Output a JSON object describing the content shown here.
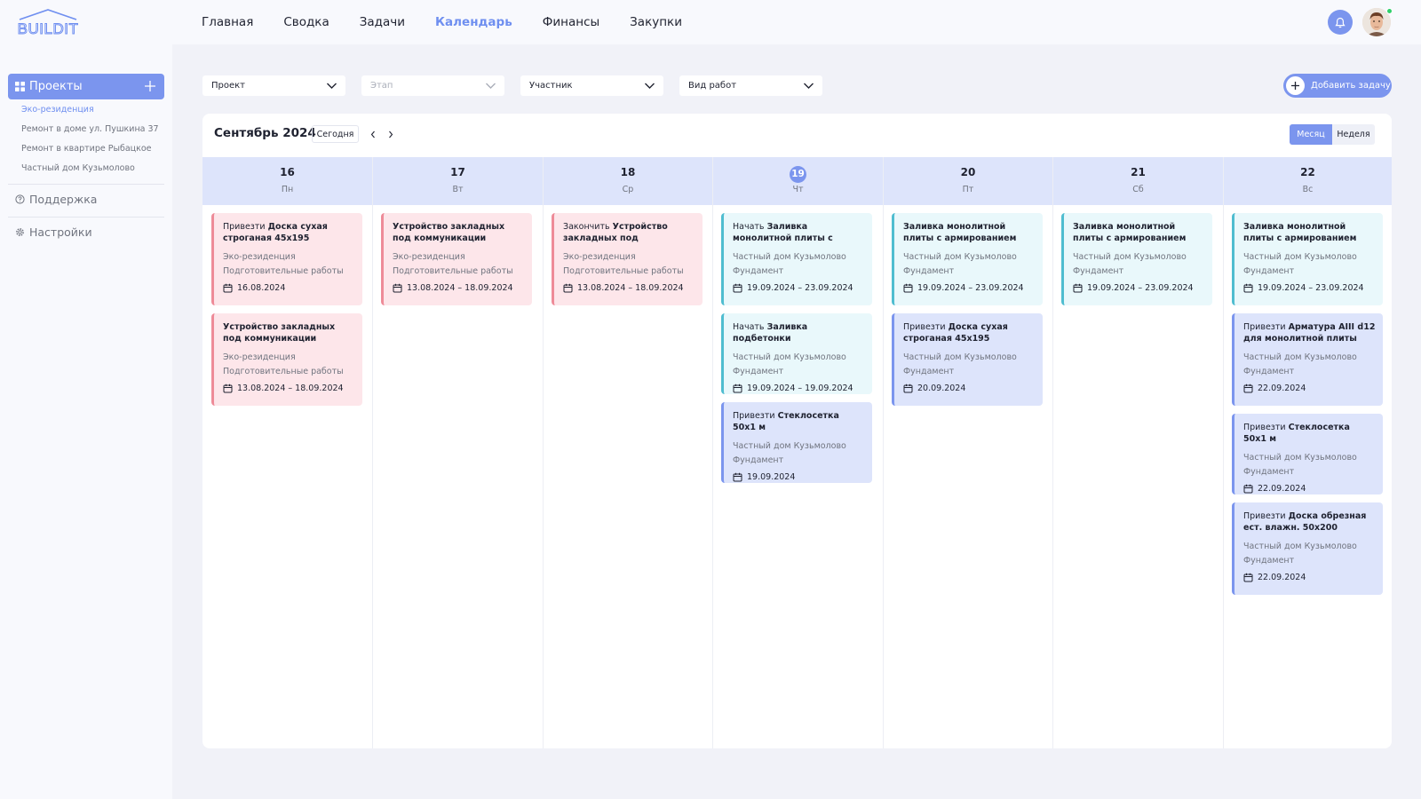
{
  "app": {
    "logo_text": "BUILDIT"
  },
  "nav": [
    {
      "label": "Главная"
    },
    {
      "label": "Сводка"
    },
    {
      "label": "Задачи"
    },
    {
      "label": "Календарь",
      "active": true
    },
    {
      "label": "Финансы"
    },
    {
      "label": "Закупки"
    }
  ],
  "sidebar": {
    "projects_label": "Проекты",
    "projects": [
      "Эко-резиденция",
      "Ремонт в доме ул. Пушкина 37",
      "Ремонт в квартире Рыбацкое",
      "Частный дом Кузьмолово"
    ],
    "support_label": "Поддержка",
    "settings_label": "Настройки"
  },
  "filters": [
    {
      "label": "Проект"
    },
    {
      "label": "Этап",
      "disabled": true
    },
    {
      "label": "Участник"
    },
    {
      "label": "Вид работ"
    }
  ],
  "add_task_label": "Добавить задачу",
  "calendar": {
    "title": "Сентябрь 2024",
    "today_label": "Сегодня",
    "view_month": "Месяц",
    "view_week": "Неделя",
    "days": [
      {
        "num": "16",
        "weekday": "Пн",
        "tasks": [
          {
            "color": "red",
            "prefix": "Привезти",
            "title": "Доска сухая строганая 45х195",
            "project": "Эко-резиденция",
            "stage": "Подготовительные работы",
            "date": "16.08.2024"
          },
          {
            "color": "red",
            "prefix": "",
            "title": "Устройство закладных под коммуникации",
            "project": "Эко-резиденция",
            "stage": "Подготовительные работы",
            "date": "13.08.2024 – 18.09.2024"
          }
        ]
      },
      {
        "num": "17",
        "weekday": "Вт",
        "tasks": [
          {
            "color": "red",
            "prefix": "",
            "title": "Устройство закладных под коммуникации",
            "project": "Эко-резиденция",
            "stage": "Подготовительные работы",
            "date": "13.08.2024 – 18.09.2024"
          }
        ]
      },
      {
        "num": "18",
        "weekday": "Ср",
        "tasks": [
          {
            "color": "red",
            "prefix": "Закончить",
            "title": "Устройство закладных под коммуникац...",
            "project": "Эко-резиденция",
            "stage": "Подготовительные работы",
            "date": "13.08.2024 – 18.09.2024"
          }
        ]
      },
      {
        "num": "19",
        "weekday": "Чт",
        "today": true,
        "tasks": [
          {
            "color": "teal",
            "prefix": "Начать",
            "title": "Заливка монолитной плиты с армированием",
            "project": "Частный дом Кузьмолово",
            "stage": "Фундамент",
            "date": "19.09.2024 – 23.09.2024"
          },
          {
            "color": "teal",
            "prefix": "Начать",
            "title": "Заливка подбетонки",
            "project": "Частный дом Кузьмолово",
            "stage": "Фундамент",
            "date": "19.09.2024 – 19.09.2024"
          },
          {
            "color": "blue",
            "prefix": "Привезти",
            "title": "Стеклосетка 50х1 м",
            "project": "Частный дом Кузьмолово",
            "stage": "Фундамент",
            "date": "19.09.2024"
          }
        ]
      },
      {
        "num": "20",
        "weekday": "Пт",
        "tasks": [
          {
            "color": "teal",
            "prefix": "",
            "title": "Заливка монолитной плиты с армированием",
            "project": "Частный дом Кузьмолово",
            "stage": "Фундамент",
            "date": "19.09.2024 – 23.09.2024"
          },
          {
            "color": "blue",
            "prefix": "Привезти",
            "title": "Доска сухая строганая 45х195",
            "project": "Частный дом Кузьмолово",
            "stage": "Фундамент",
            "date": "20.09.2024"
          }
        ]
      },
      {
        "num": "21",
        "weekday": "Сб",
        "tasks": [
          {
            "color": "teal",
            "prefix": "",
            "title": "Заливка монолитной плиты с армированием",
            "project": "Частный дом Кузьмолово",
            "stage": "Фундамент",
            "date": "19.09.2024 – 23.09.2024"
          }
        ]
      },
      {
        "num": "22",
        "weekday": "Вс",
        "tasks": [
          {
            "color": "teal",
            "prefix": "",
            "title": "Заливка монолитной плиты с армированием",
            "project": "Частный дом Кузьмолово",
            "stage": "Фундамент",
            "date": "19.09.2024 – 23.09.2024"
          },
          {
            "color": "blue",
            "prefix": "Привезти",
            "title": "Арматура АIII d12 для монолитной плиты",
            "project": "Частный дом Кузьмолово",
            "stage": "Фундамент",
            "date": "22.09.2024"
          },
          {
            "color": "blue",
            "prefix": "Привезти",
            "title": "Стеклосетка 50х1 м",
            "project": "Частный дом Кузьмолово",
            "stage": "Фундамент",
            "date": "22.09.2024"
          },
          {
            "color": "blue",
            "prefix": "Привезти",
            "title": "Доска обрезная ест. влажн. 50х200",
            "project": "Частный дом Кузьмолово",
            "stage": "Фундамент",
            "date": "22.09.2024"
          }
        ]
      }
    ]
  },
  "colors": {
    "accent": "#7b95ee",
    "red_border": "#ee8b98",
    "teal_border": "#4fbdd0"
  }
}
